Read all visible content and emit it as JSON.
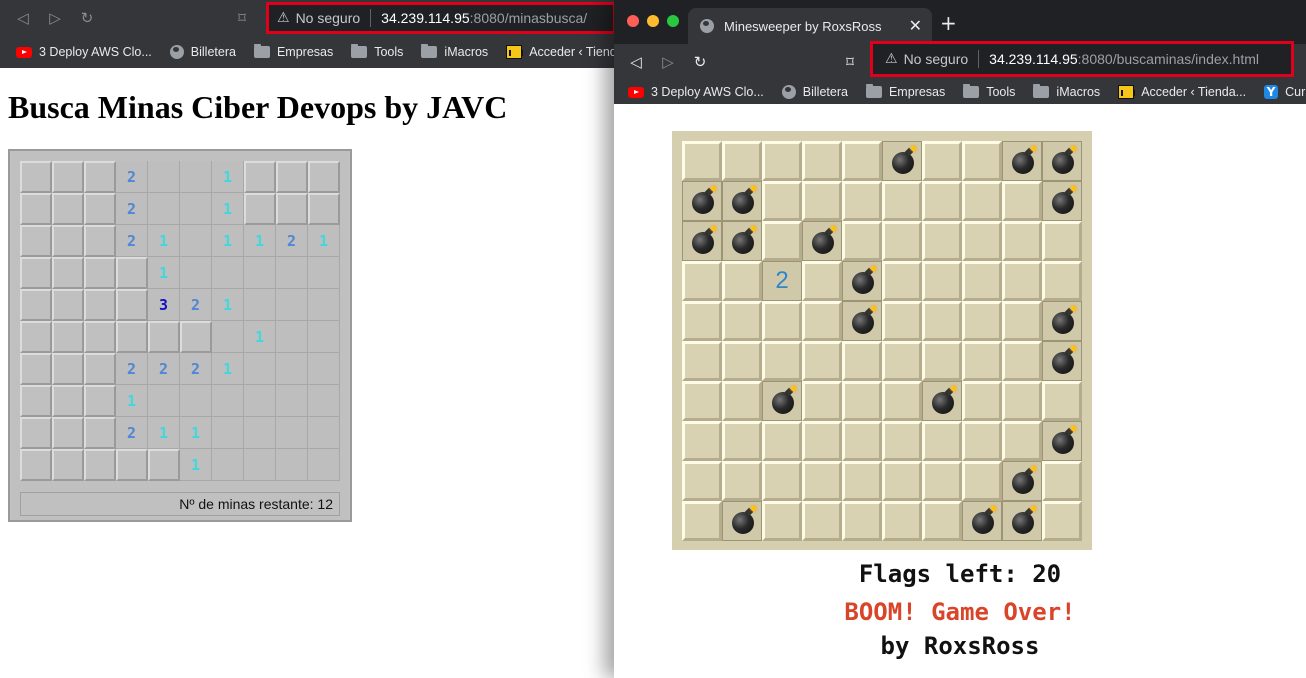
{
  "left_window": {
    "url": {
      "security_label": "No seguro",
      "host": "34.239.114.95",
      "rest": ":8080/minasbusca/"
    },
    "bookmarks": [
      "3 Deploy AWS Clo...",
      "Billetera",
      "Empresas",
      "Tools",
      "iMacros",
      "Acceder ‹ Tienda"
    ],
    "page_title": "Busca Minas Ciber Devops by JAVC",
    "mines_remaining_text": "Nº de minas restante: 12",
    "board": [
      "...2..1...",
      "...2..1...",
      "...21.1121",
      "....1.....",
      "....321...",
      ".......1...",
      "...2221...",
      "...1......",
      "...211....",
      ".....1...."
    ],
    "board_closed": [
      "CCC    CCC",
      "CCC    CCC",
      "CCC       ",
      "CCCC      ",
      "CCCC      ",
      "CCCCCC    ",
      "CCC       ",
      "CCC       ",
      "CCC       ",
      "CCCCC     "
    ],
    "number_colors": {
      "1": "#3fd8e0",
      "2": "#4f86d6",
      "3": "#1010c8"
    }
  },
  "right_window": {
    "tab_title": "Minesweeper by RoxsRoss",
    "url": {
      "security_label": "No seguro",
      "host": "34.239.114.95",
      "rest": ":8080/buscaminas/index.html"
    },
    "bookmarks": [
      "3 Deploy AWS Clo...",
      "Billetera",
      "Empresas",
      "Tools",
      "iMacros",
      "Acceder ‹ Tienda...",
      "Cur"
    ],
    "board": [
      ".....B..BB",
      "BB.......B",
      "BB.B......",
      "..2.B.....",
      "....B....B",
      ".........B",
      "..B...B...",
      ".........B",
      "........B.",
      ".B.....BB."
    ],
    "flags_left": "Flags left: 20",
    "status_message": "BOOM! Game Over!",
    "credit": "by RoxsRoss"
  }
}
